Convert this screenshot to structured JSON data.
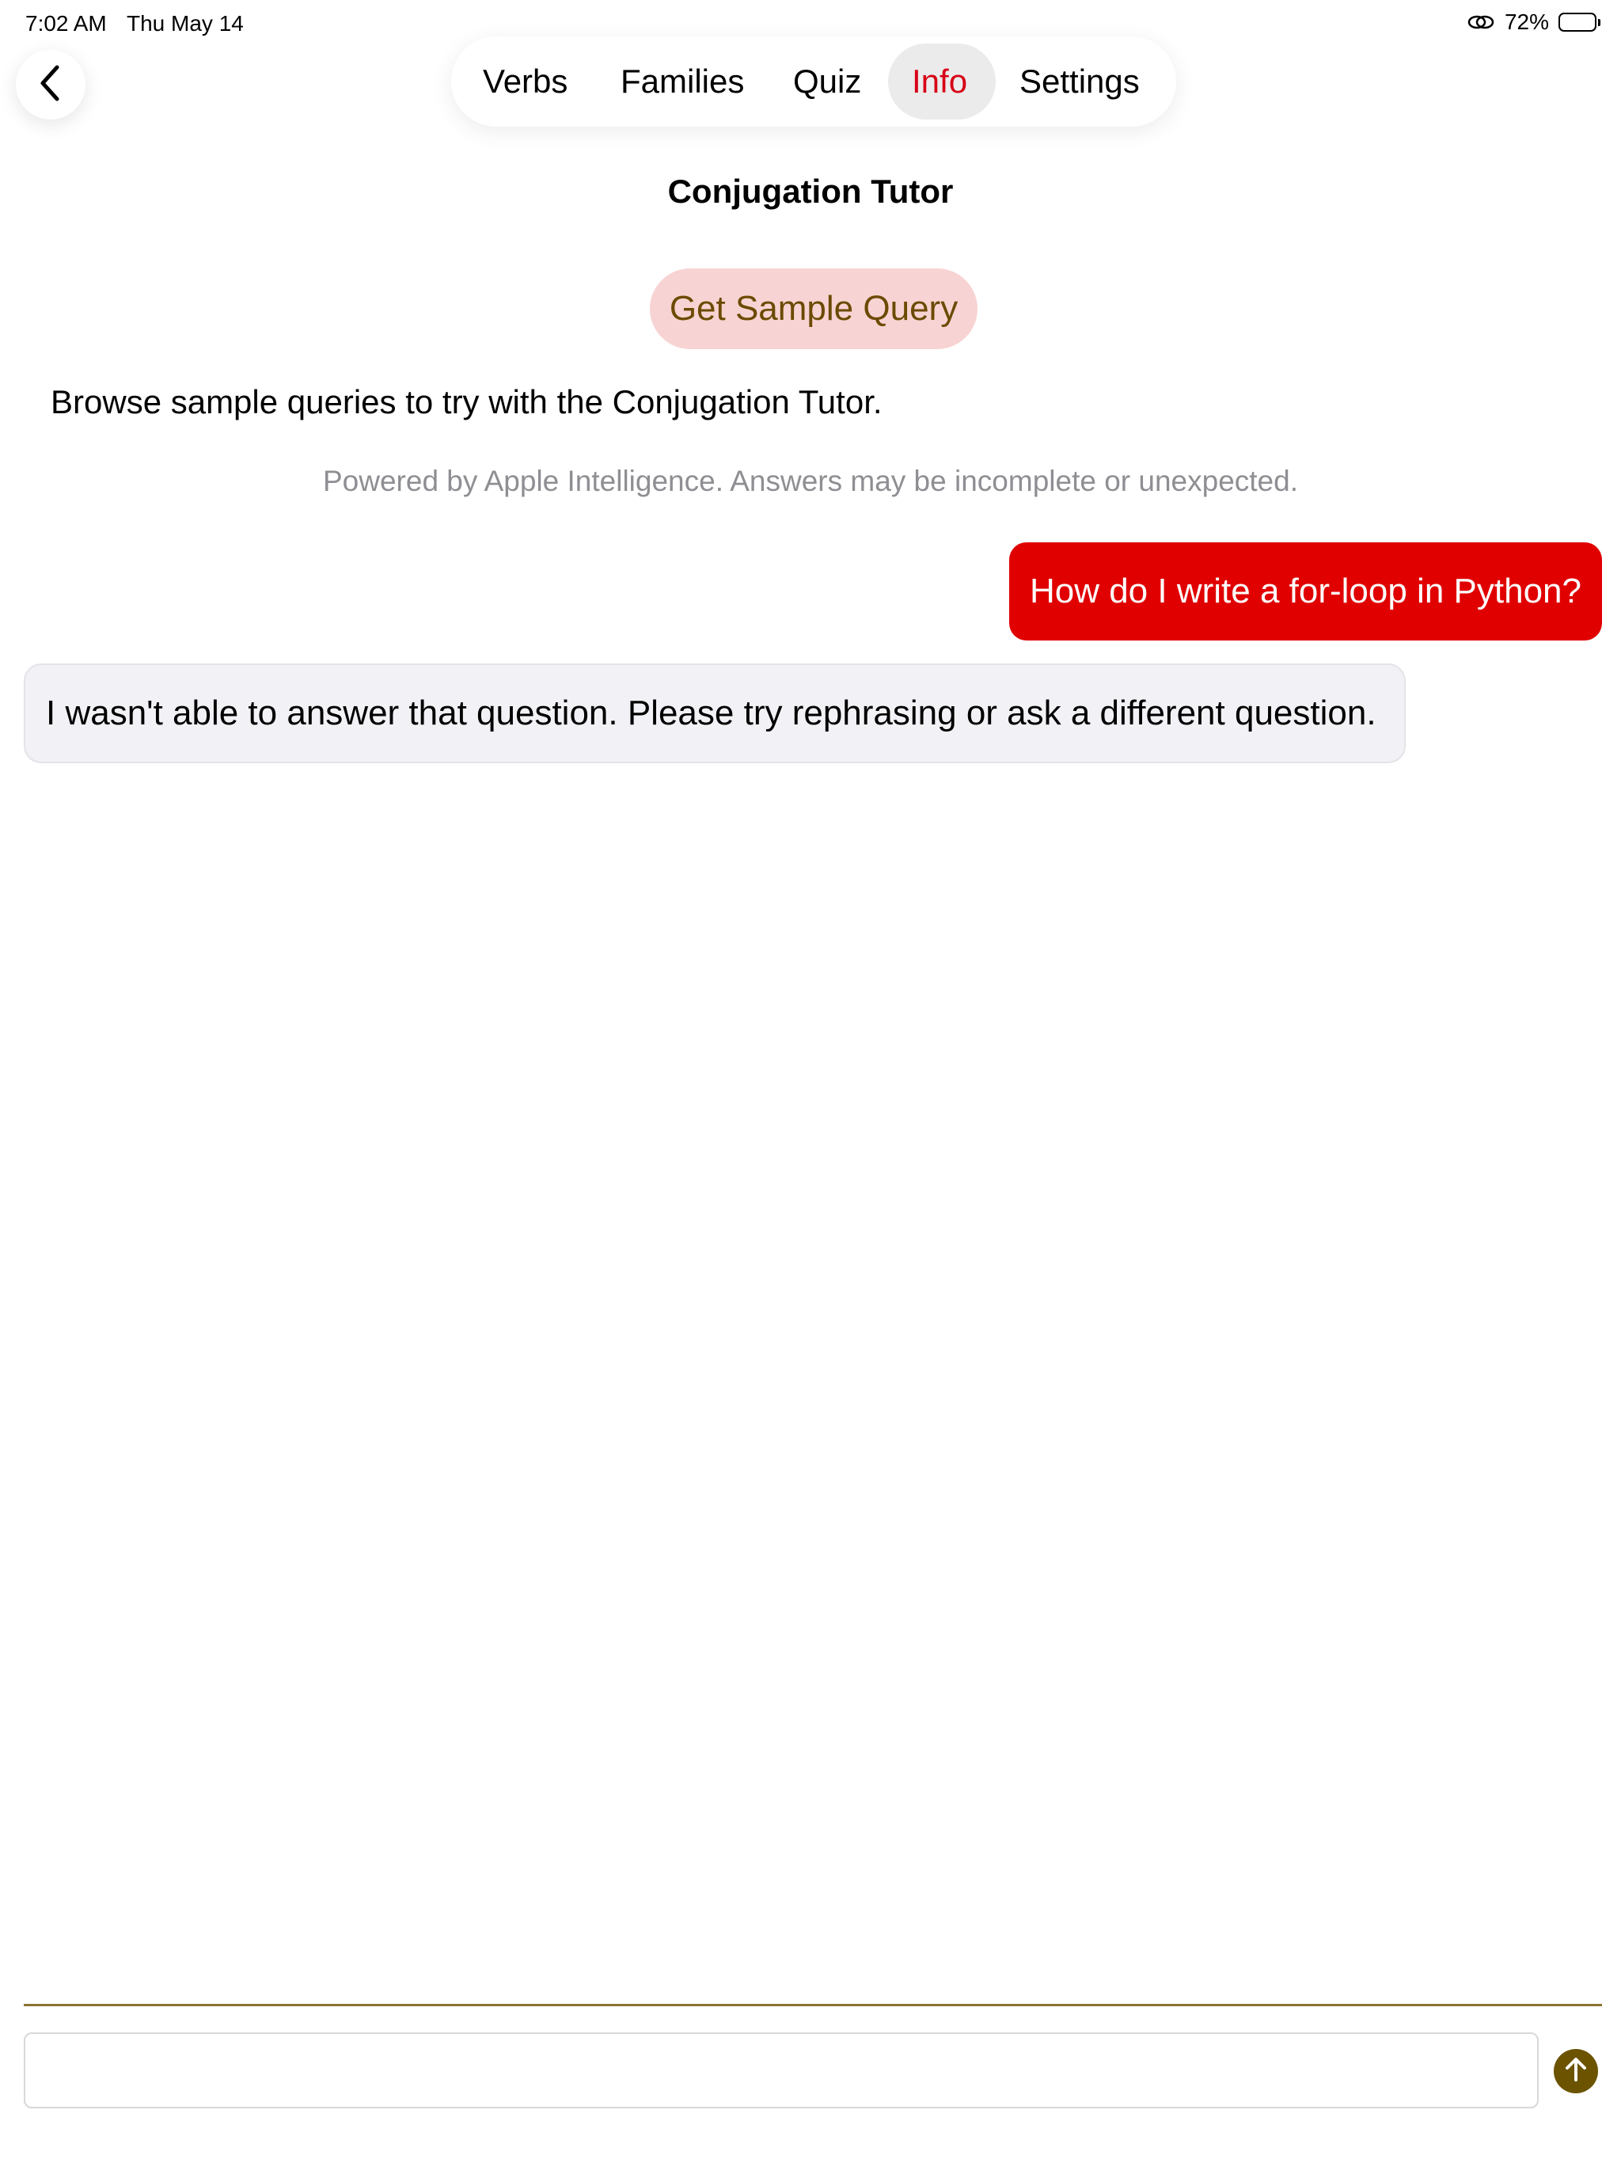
{
  "status_bar": {
    "time": "7:02 AM",
    "date": "Thu May 14",
    "battery_percent": "72%",
    "battery_level": 0.72
  },
  "nav": {
    "back_icon": "chevron-left-icon",
    "tabs": [
      {
        "label": "Verbs",
        "active": false
      },
      {
        "label": "Families",
        "active": false
      },
      {
        "label": "Quiz",
        "active": false
      },
      {
        "label": "Info",
        "active": true
      },
      {
        "label": "Settings",
        "active": false
      }
    ]
  },
  "page": {
    "title": "Conjugation Tutor",
    "sample_button_label": "Get Sample Query",
    "description": "Browse sample queries to try with the Conjugation Tutor.",
    "disclaimer": "Powered by Apple Intelligence. Answers may be incomplete or unexpected."
  },
  "messages": [
    {
      "role": "user",
      "text": "How do I write a for-loop in Python?"
    },
    {
      "role": "assistant",
      "text": "I wasn't able to answer that question. Please try rephrasing or ask a different question."
    }
  ],
  "composer": {
    "input_value": "",
    "send_icon": "arrow-up-icon"
  },
  "colors": {
    "accent_red": "#d70015",
    "user_bubble": "#e00000",
    "sample_button_bg": "#f8d3d3",
    "sample_button_text": "#6b4a00",
    "send_button": "#6b5300",
    "divider": "#8a7433",
    "assistant_bubble": "#f2f2f6"
  }
}
